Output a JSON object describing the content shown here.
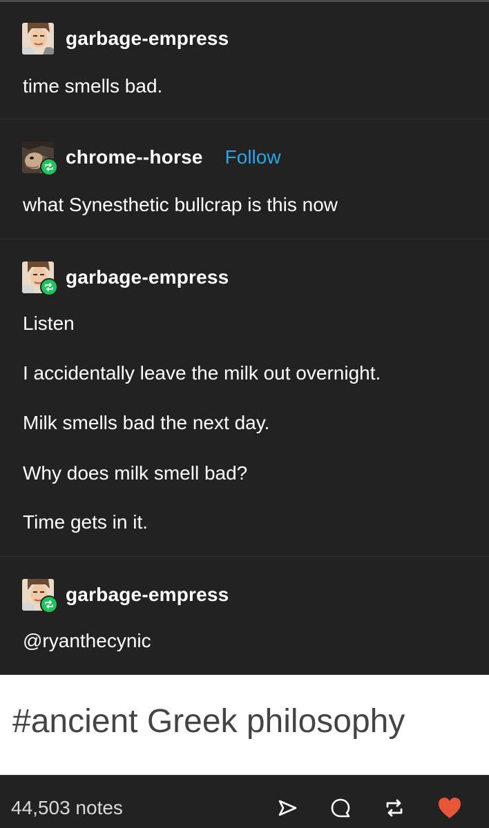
{
  "posts": [
    {
      "username": "garbage-empress",
      "reblog": false,
      "follow_label": "",
      "lines": [
        "time smells bad."
      ]
    },
    {
      "username": "chrome--horse",
      "reblog": true,
      "follow_label": "Follow",
      "lines": [
        "what Synesthetic bullcrap is this now"
      ]
    },
    {
      "username": "garbage-empress",
      "reblog": true,
      "follow_label": "",
      "lines": [
        "Listen",
        "I accidentally leave the milk out overnight.",
        "Milk smells bad the next day.",
        "Why does milk smell bad?",
        "Time gets in it."
      ]
    },
    {
      "username": "garbage-empress",
      "reblog": true,
      "follow_label": "",
      "lines": [
        "@ryanthecynic"
      ]
    }
  ],
  "tags": {
    "text": "#ancient Greek philosophy"
  },
  "footer": {
    "notes": "44,503 notes",
    "icons": [
      "share-icon",
      "reply-icon",
      "reblog-icon",
      "like-icon"
    ],
    "like_color": "#e8563a"
  },
  "colors": {
    "background": "#222222",
    "follow": "#2aa6e8",
    "reblog_badge": "#1fc45c"
  }
}
